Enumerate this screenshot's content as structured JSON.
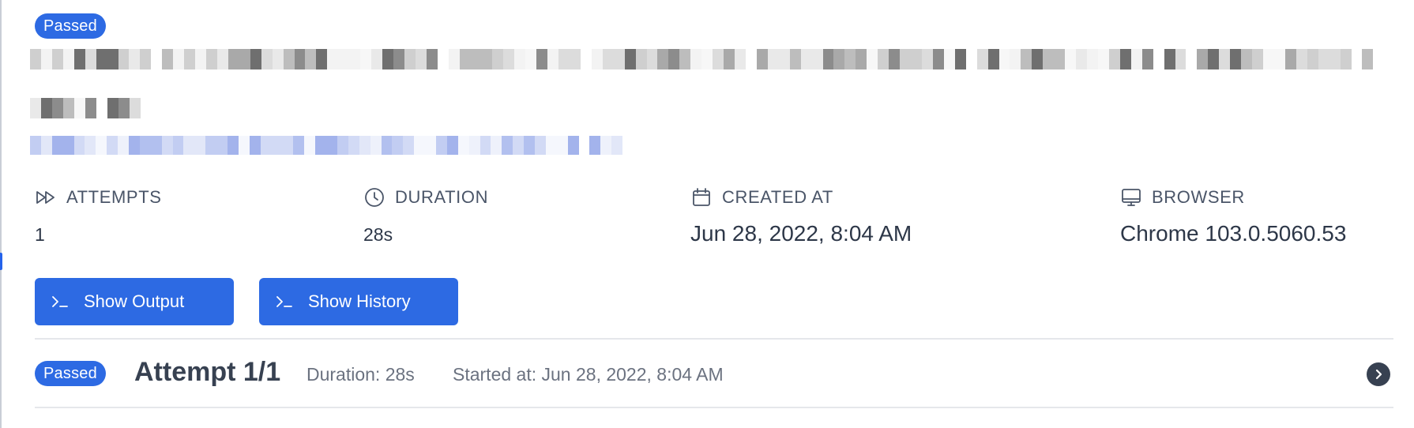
{
  "test": {
    "status_badge": "Passed",
    "title_redacted": true,
    "url_redacted": true
  },
  "meta": {
    "attempts": {
      "label": "ATTEMPTS",
      "value": "1",
      "icon": "fast-forward-icon"
    },
    "duration": {
      "label": "DURATION",
      "value": "28s",
      "icon": "clock-icon"
    },
    "created_at": {
      "label": "CREATED AT",
      "value": "Jun 28, 2022, 8:04 AM",
      "icon": "calendar-icon"
    },
    "browser": {
      "label": "BROWSER",
      "value": "Chrome 103.0.5060.53",
      "icon": "monitor-icon"
    }
  },
  "actions": {
    "show_output": "Show Output",
    "show_history": "Show History"
  },
  "attempt": {
    "status_badge": "Passed",
    "title": "Attempt 1/1",
    "duration": "Duration: 28s",
    "started": "Started at: Jun 28, 2022, 8:04 AM"
  },
  "colors": {
    "accent": "#2d6ae3",
    "text": "#2d3748",
    "muted": "#6b7280",
    "divider": "#e5e7eb"
  }
}
